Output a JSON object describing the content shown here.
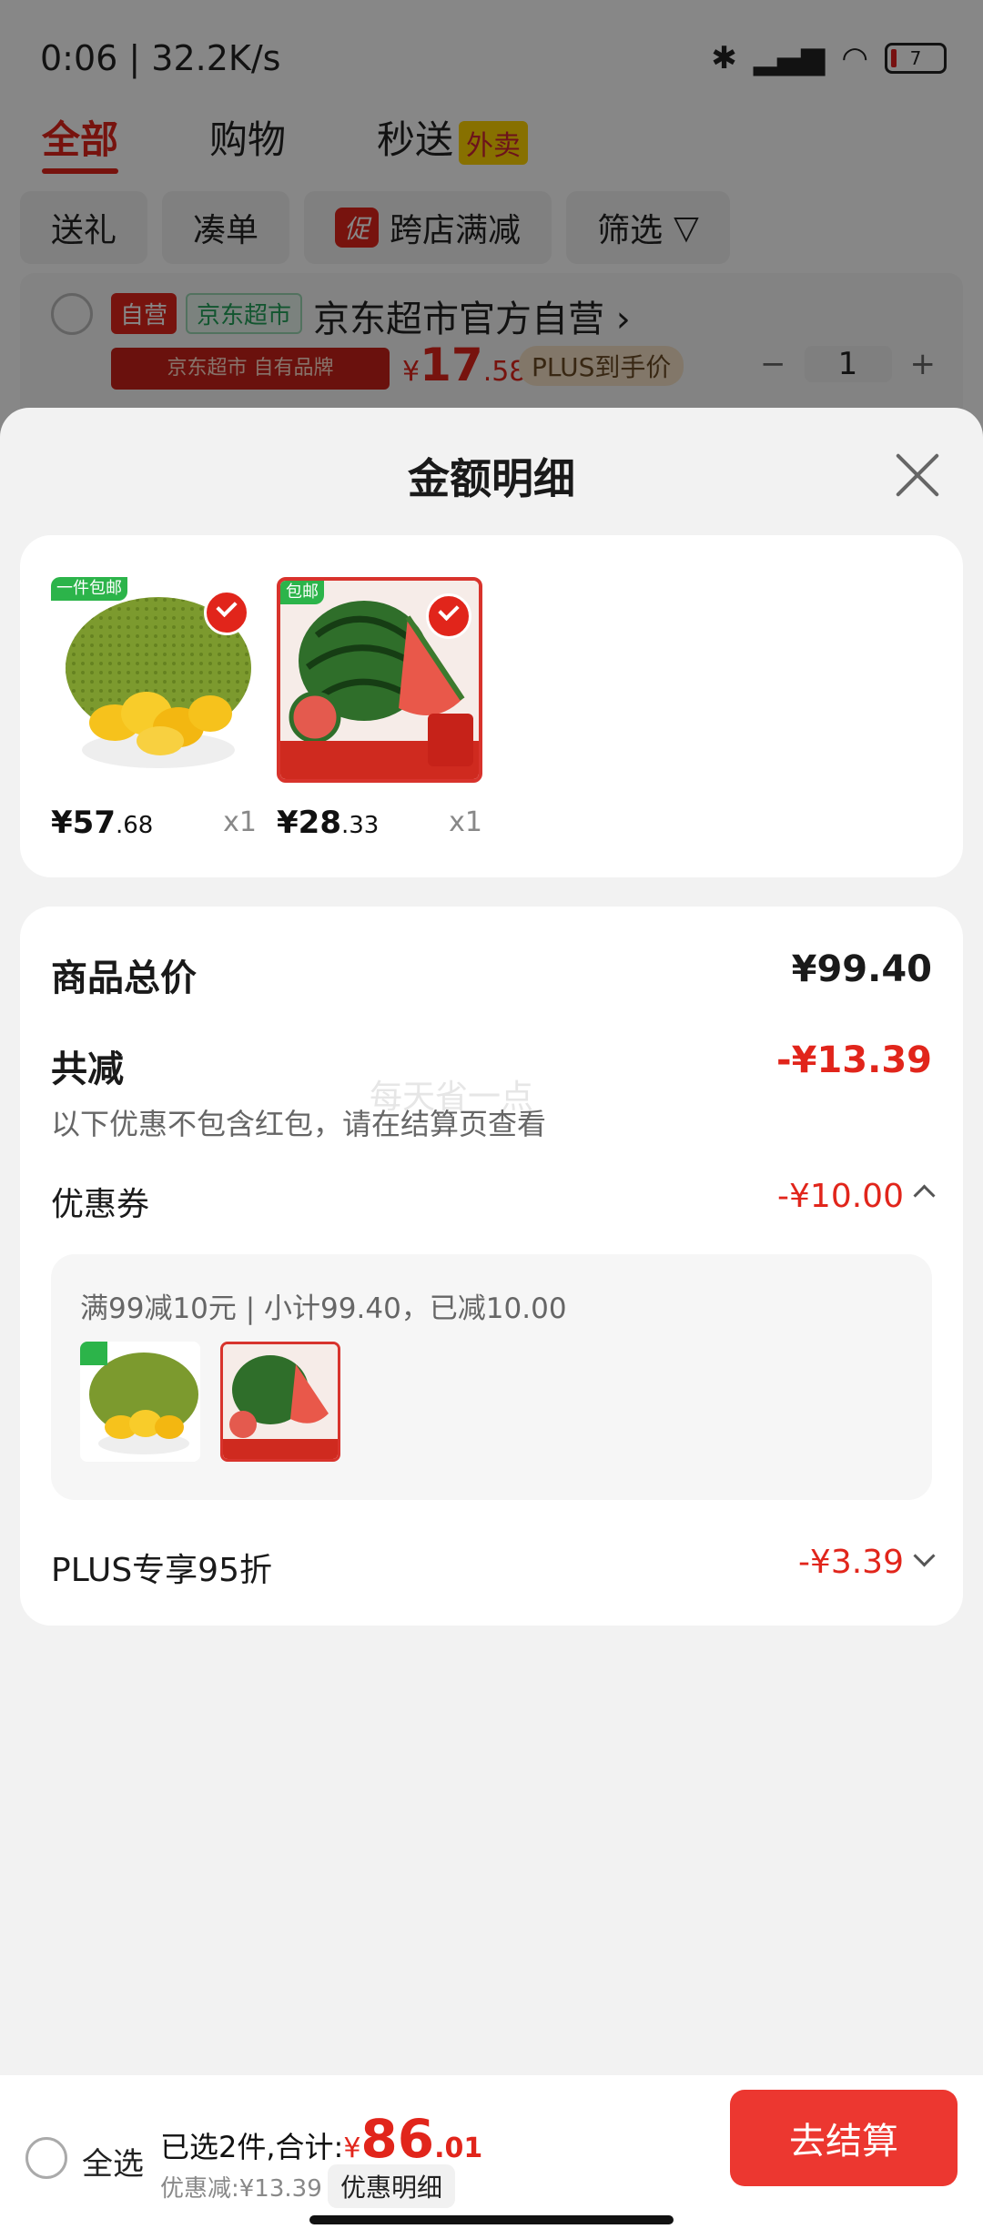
{
  "status": {
    "time": "0:06 | 32.2K/s",
    "battery": "7"
  },
  "tabs": [
    {
      "label": "全部"
    },
    {
      "label": "购物"
    },
    {
      "label": "秒送",
      "tag": "外卖"
    }
  ],
  "chips": [
    {
      "label": "送礼"
    },
    {
      "label": "凑单"
    },
    {
      "label": "跨店满减",
      "badge": "促"
    },
    {
      "label": "筛选"
    }
  ],
  "shop": {
    "self_tag": "自营",
    "mart_tag": "京东超市",
    "name": "京东超市官方自营",
    "brand_banner": "京东超市 自有品牌",
    "price_symbol": "¥",
    "price_int": "17",
    "price_dec": ".58",
    "plus_label": "PLUS到手价",
    "qty": "1"
  },
  "sheet": {
    "title": "金额明细",
    "products": [
      {
        "name": "jackfruit",
        "price_int": "¥57",
        "price_dec": ".68",
        "qty": "x1",
        "badge": "一件包邮"
      },
      {
        "name": "watermelon",
        "price_int": "¥28",
        "price_dec": ".33",
        "qty": "x1",
        "badge": "包邮"
      }
    ],
    "summary": {
      "total_label": "商品总价",
      "total_value": "¥99.40",
      "reduce_label": "共减",
      "reduce_value": "-¥13.39",
      "reduce_note": "以下优惠不包含红包，请在结算页查看",
      "watermark": "每天省一点",
      "coupon_label": "优惠券",
      "coupon_value": "-¥10.00",
      "coupon_detail": "满99减10元 | 小计99.40，已减10.00",
      "plus_label": "PLUS专享95折",
      "plus_value": "-¥3.39"
    }
  },
  "bottom_bar": {
    "select_all": "全选",
    "selected_text": "已选2件,合计:",
    "total_symbol": "¥",
    "total_int": "86",
    "total_dec": ".01",
    "discount_text": "优惠减:¥13.39",
    "detail_btn": "优惠明细",
    "checkout_btn": "去结算"
  },
  "colors": {
    "accent": "#e1251b",
    "checkout": "#ec3730",
    "plus_bg": "#f5e1c6"
  }
}
